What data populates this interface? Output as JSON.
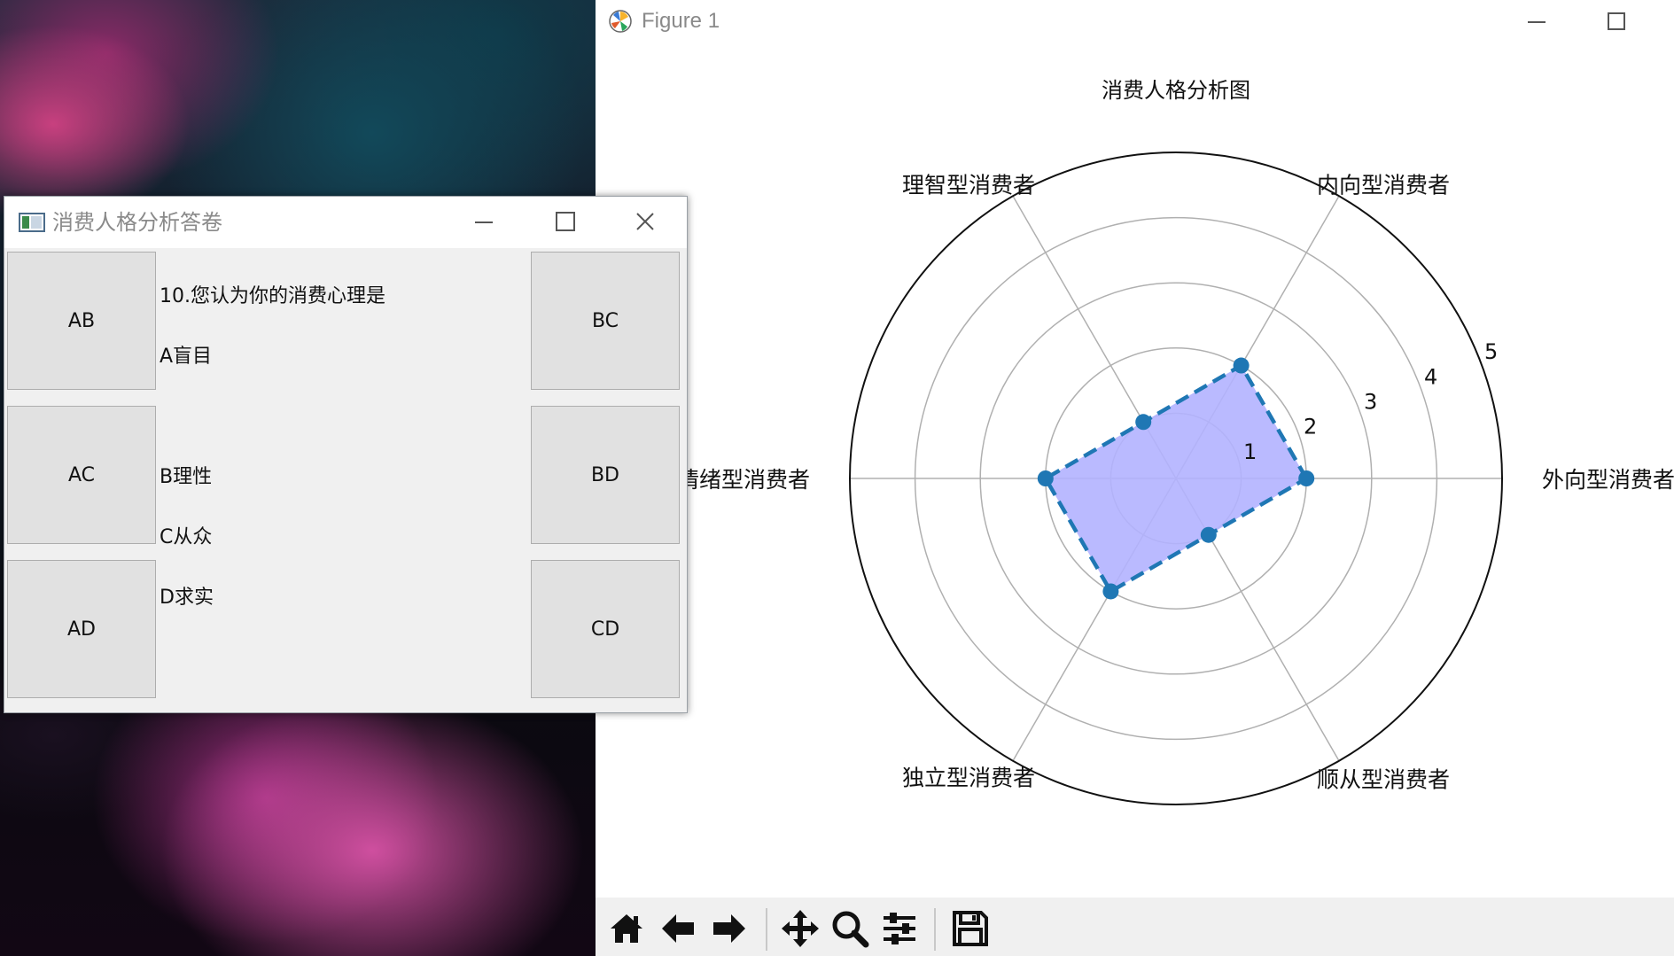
{
  "figure_window": {
    "title": "Figure 1",
    "toolbar": {
      "home": "home-icon",
      "back": "back-arrow-icon",
      "forward": "forward-arrow-icon",
      "pan": "move-icon",
      "zoom": "zoom-icon",
      "configure": "sliders-icon",
      "save": "save-icon"
    }
  },
  "chart_data": {
    "type": "radar",
    "title": "消费人格分析图",
    "categories": [
      "外向型消费者",
      "内向型消费者",
      "理智型消费者",
      "情绪型消费者",
      "独立型消费者",
      "顺从型消费者"
    ],
    "values": [
      2,
      2,
      1,
      2,
      2,
      1
    ],
    "radial_ticks": [
      "1",
      "2",
      "3",
      "4",
      "5"
    ],
    "rlim": [
      0,
      5
    ],
    "grid": true,
    "style": {
      "line_color": "#1f77b4",
      "line_style": "dashed",
      "fill_color": "#b3b3ff",
      "marker": "circle"
    }
  },
  "quiz_window": {
    "title": "消费人格分析答卷",
    "question_lines": [
      "10.您认为你的消费心理是",
      "A盲目",
      "",
      "B理性",
      "C从众",
      "D求实"
    ],
    "buttons": {
      "ab": "AB",
      "ac": "AC",
      "ad": "AD",
      "bc": "BC",
      "bd": "BD",
      "cd": "CD"
    }
  }
}
